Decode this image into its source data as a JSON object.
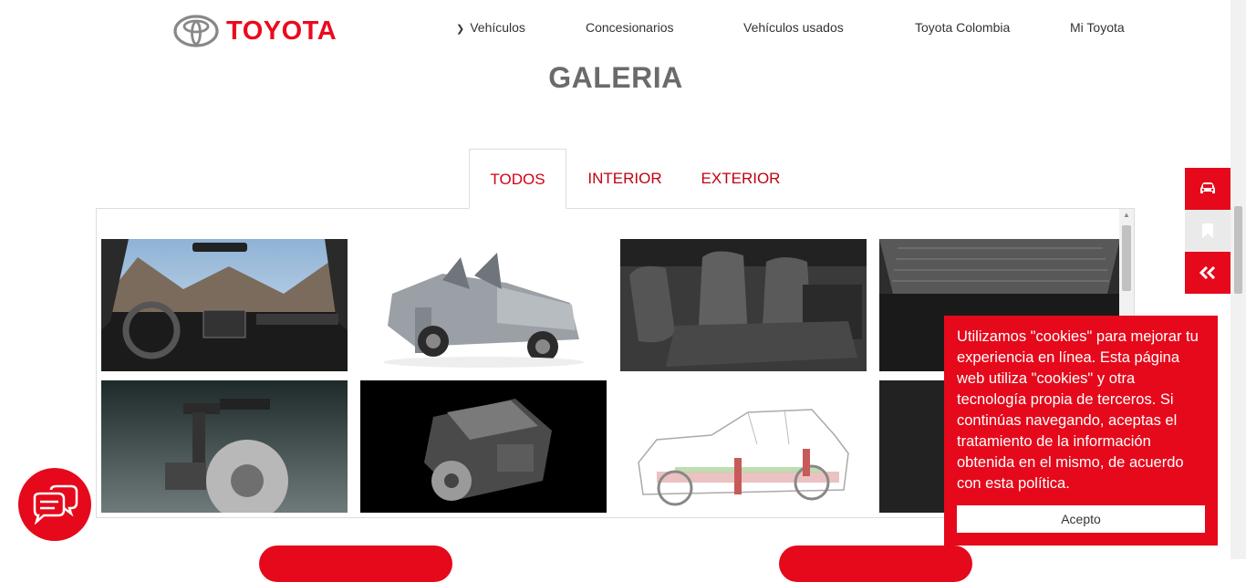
{
  "header": {
    "brand": "TOYOTA",
    "nav": [
      {
        "label": "Vehículos",
        "has_dropdown": true
      },
      {
        "label": "Concesionarios"
      },
      {
        "label": "Vehículos usados"
      },
      {
        "label": "Toyota Colombia"
      },
      {
        "label": "Mi Toyota"
      }
    ]
  },
  "page_title": "GALERIA",
  "tabs": [
    {
      "label": "TODOS",
      "active": true
    },
    {
      "label": "INTERIOR",
      "active": false
    },
    {
      "label": "EXTERIOR",
      "active": false
    }
  ],
  "gallery": {
    "images": [
      {
        "icon": "dashboard-interior-image"
      },
      {
        "icon": "pickup-doors-open-image"
      },
      {
        "icon": "seats-interior-image"
      },
      {
        "icon": "truck-bed-image"
      },
      {
        "icon": "suspension-brake-image"
      },
      {
        "icon": "engine-image"
      },
      {
        "icon": "chassis-diagram-image"
      },
      {
        "icon": "partial-image"
      }
    ]
  },
  "side_buttons": [
    {
      "icon": "car-icon"
    },
    {
      "icon": "bookmark-icon"
    },
    {
      "icon": "double-chevron-left-icon"
    }
  ],
  "cookie_banner": {
    "text": "Utilizamos \"cookies\" para mejorar tu experiencia en línea. Esta página web utiliza \"cookies\" y otra tecnología propia de terceros. Si continúas navegando, aceptas el tratamiento de la información obtenida en el mismo, de acuerdo con esta política.",
    "accept_label": "Acepto"
  },
  "colors": {
    "brand_red": "#eb0a1e",
    "banner_red": "#e5091b",
    "title_gray": "#6b6b6b"
  }
}
